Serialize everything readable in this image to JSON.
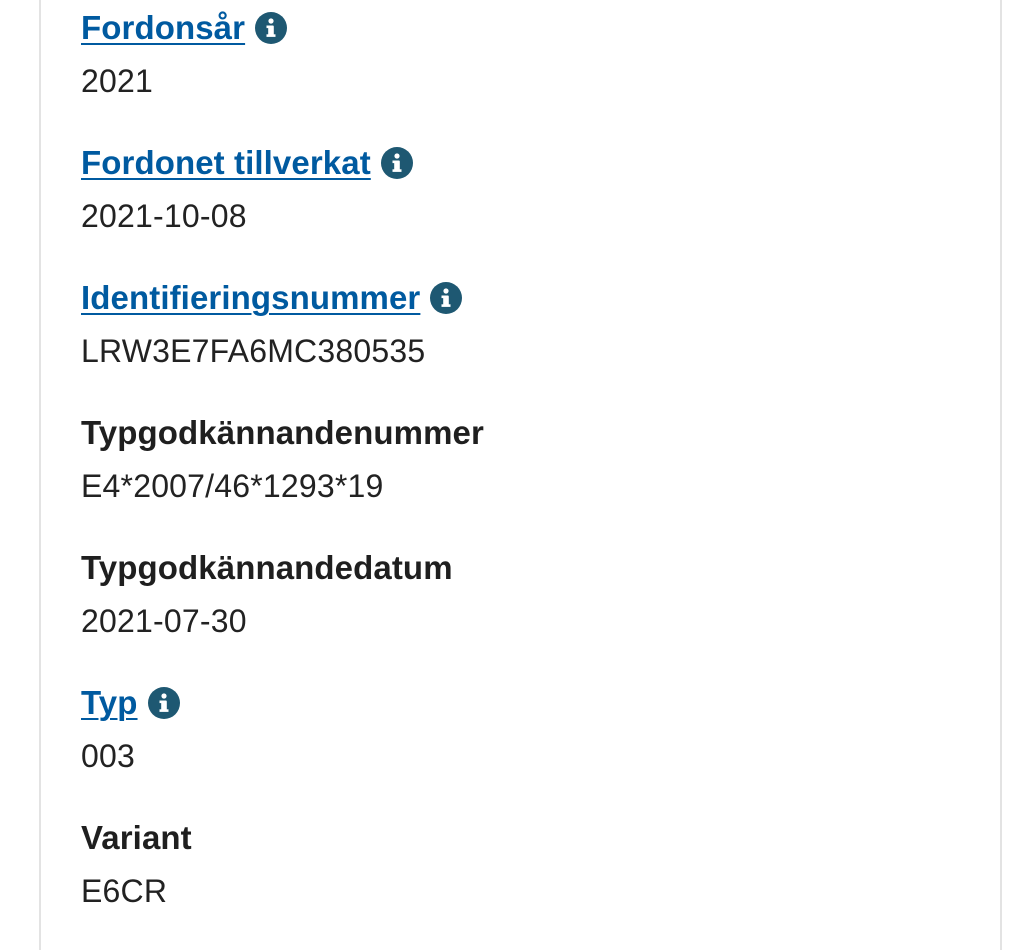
{
  "vehicle_details": {
    "fields": [
      {
        "label": "Fordonsår",
        "value": "2021",
        "has_info": true
      },
      {
        "label": "Fordonet tillverkat",
        "value": "2021-10-08",
        "has_info": true
      },
      {
        "label": "Identifieringsnummer",
        "value": "LRW3E7FA6MC380535",
        "has_info": true
      },
      {
        "label": "Typgodkännandenummer",
        "value": "E4*2007/46*1293*19",
        "has_info": false
      },
      {
        "label": "Typgodkännandedatum",
        "value": "2021-07-30",
        "has_info": false
      },
      {
        "label": "Typ",
        "value": "003",
        "has_info": true
      },
      {
        "label": "Variant",
        "value": "E6CR",
        "has_info": false
      }
    ]
  },
  "icons": {
    "info": "info-circle-icon"
  },
  "colors": {
    "link": "#005aa0",
    "info_icon_bg": "#1e5872",
    "text": "#222222",
    "border": "#e3e3e3"
  }
}
